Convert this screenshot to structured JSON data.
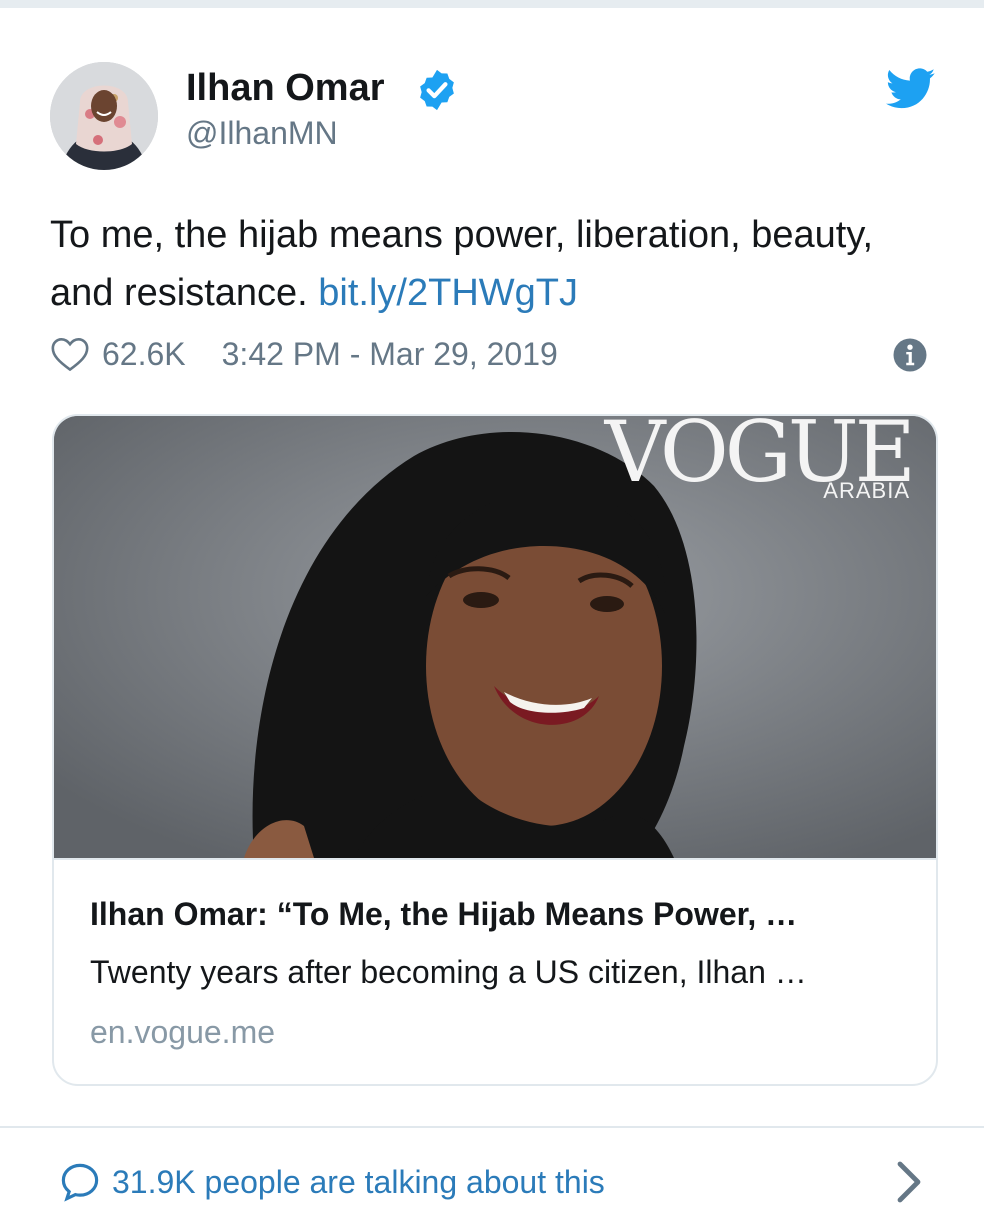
{
  "author": {
    "name": "Ilhan Omar",
    "handle": "@IlhanMN",
    "avatar_icon": "profile-photo",
    "verified_icon": "verified-badge-icon"
  },
  "tweet": {
    "text": "To me, the hijab means power, liberation, beauty, and resistance.",
    "link": "bit.ly/2THWgTJ",
    "likes": "62.6K",
    "timestamp": "3:42 PM - Mar 29, 2019"
  },
  "card": {
    "image_magazine_title": "VOGUE",
    "image_magazine_subtitle": "ARABIA",
    "title": "Ilhan Omar: “To Me, the Hijab Means Power, …",
    "description": "Twenty years after becoming a US citizen, Ilhan …",
    "domain": "en.vogue.me"
  },
  "footer": {
    "conversation_label": "31.9K people are talking about this"
  },
  "colors": {
    "link": "#2b7bb9",
    "secondary_text": "#657786",
    "twitter_blue": "#1da1f2",
    "border": "#e1e8ed"
  }
}
